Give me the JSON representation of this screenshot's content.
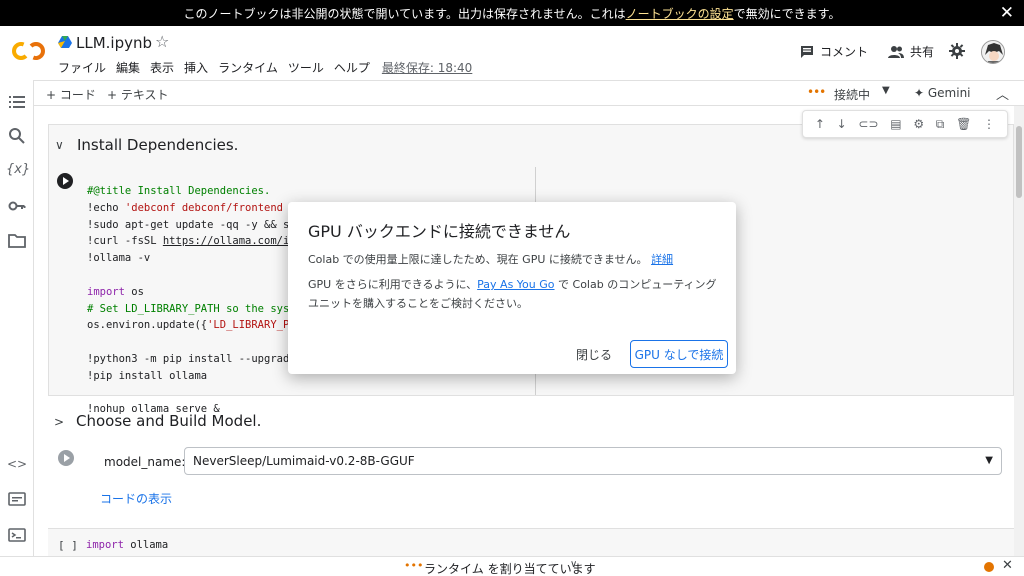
{
  "notice": {
    "text_before": "このノートブックは非公開の状態で開いています。出力は保存されません。これは",
    "link": "ノートブックの設定",
    "text_after": "で無効にできます。",
    "close": "✕"
  },
  "header": {
    "title": "LLM.ipynb",
    "menu": [
      "ファイル",
      "編集",
      "表示",
      "挿入",
      "ランタイム",
      "ツール",
      "ヘルプ"
    ],
    "last_saved": "最終保存: 18:40",
    "comment": "コメント",
    "share": "共有"
  },
  "toolbar": {
    "add_code": "+ コード",
    "add_text": "+ テキスト",
    "connection": "接続中",
    "gemini": "✦ Gemini"
  },
  "cells": {
    "section1_title": "Install Dependencies.",
    "code_lines": [
      {
        "parts": [
          {
            "t": "#@title Install Dependencies.",
            "c": "cm"
          }
        ]
      },
      {
        "parts": [
          {
            "t": "!echo ",
            "c": ""
          },
          {
            "t": "'debconf debconf/frontend select Noninteractive'",
            "c": "st"
          },
          {
            "t": " | sudo debconf-",
            "c": ""
          },
          {
            "t": "set",
            "c": "kw"
          },
          {
            "t": "-selections",
            "c": ""
          }
        ]
      },
      {
        "parts": [
          {
            "t": "!sudo apt-get update -qq -y && sudo",
            "c": ""
          }
        ]
      },
      {
        "parts": [
          {
            "t": "!curl -fsSL ",
            "c": ""
          },
          {
            "t": "https://ollama.com/insta",
            "c": "ul"
          }
        ]
      },
      {
        "parts": [
          {
            "t": "!ollama -v",
            "c": ""
          }
        ]
      },
      {
        "parts": [
          {
            "t": "",
            "c": ""
          }
        ]
      },
      {
        "parts": [
          {
            "t": "import",
            "c": "kw"
          },
          {
            "t": " os",
            "c": ""
          }
        ]
      },
      {
        "parts": [
          {
            "t": "# Set LD_LIBRARY_PATH so the system",
            "c": "cm"
          }
        ]
      },
      {
        "parts": [
          {
            "t": "os.environ.update({",
            "c": ""
          },
          {
            "t": "'LD_LIBRARY_PATH'",
            "c": "st"
          }
        ]
      },
      {
        "parts": [
          {
            "t": "",
            "c": ""
          }
        ]
      },
      {
        "parts": [
          {
            "t": "!python3 -m pip install --upgrade pi",
            "c": ""
          }
        ]
      },
      {
        "parts": [
          {
            "t": "!pip install ollama",
            "c": ""
          }
        ]
      },
      {
        "parts": [
          {
            "t": "",
            "c": ""
          }
        ]
      },
      {
        "parts": [
          {
            "t": "!nohup ollama serve &",
            "c": ""
          }
        ]
      }
    ],
    "section2_title": "Choose and Build Model.",
    "param_label": "model_name:",
    "model_value": "NeverSleep/Lumimaid-v0.2-8B-GGUF",
    "show_code": "コードの表示",
    "cell3_brackets": "[ ]",
    "cell3_kw": "import",
    "cell3_rest": " ollama"
  },
  "status": {
    "text": "ランタイム を割り当てています"
  },
  "dialog": {
    "title": "GPU バックエンドに接続できません",
    "p1_text": "Colab での使用量上限に達したため、現在 GPU に接続できません。",
    "p1_link": "詳細",
    "p2_before": "GPU をさらに利用できるように、",
    "p2_link": "Pay As You Go",
    "p2_after": " で Colab のコンピューティング ユニットを購入することをご検討ください。",
    "close": "閉じる",
    "connect": "GPU なしで接続"
  },
  "colors": {
    "accent": "#1a73e8",
    "warning": "#e37400",
    "notice_bg": "#000000",
    "notice_link": "#fde293"
  }
}
